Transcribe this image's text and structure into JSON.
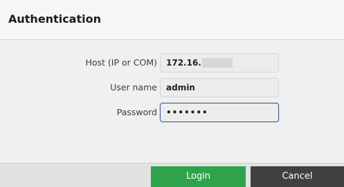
{
  "dialog": {
    "title": "Authentication"
  },
  "form": {
    "host": {
      "label": "Host (IP or COM)",
      "value": "172.16."
    },
    "username": {
      "label": "User name",
      "value": "admin"
    },
    "password": {
      "label": "Password",
      "value": "•••••••"
    }
  },
  "buttons": {
    "login": "Login",
    "cancel": "Cancel"
  },
  "colors": {
    "login_button": "#2ea34b",
    "cancel_button": "#404040",
    "focus_border": "#3a5f95"
  }
}
